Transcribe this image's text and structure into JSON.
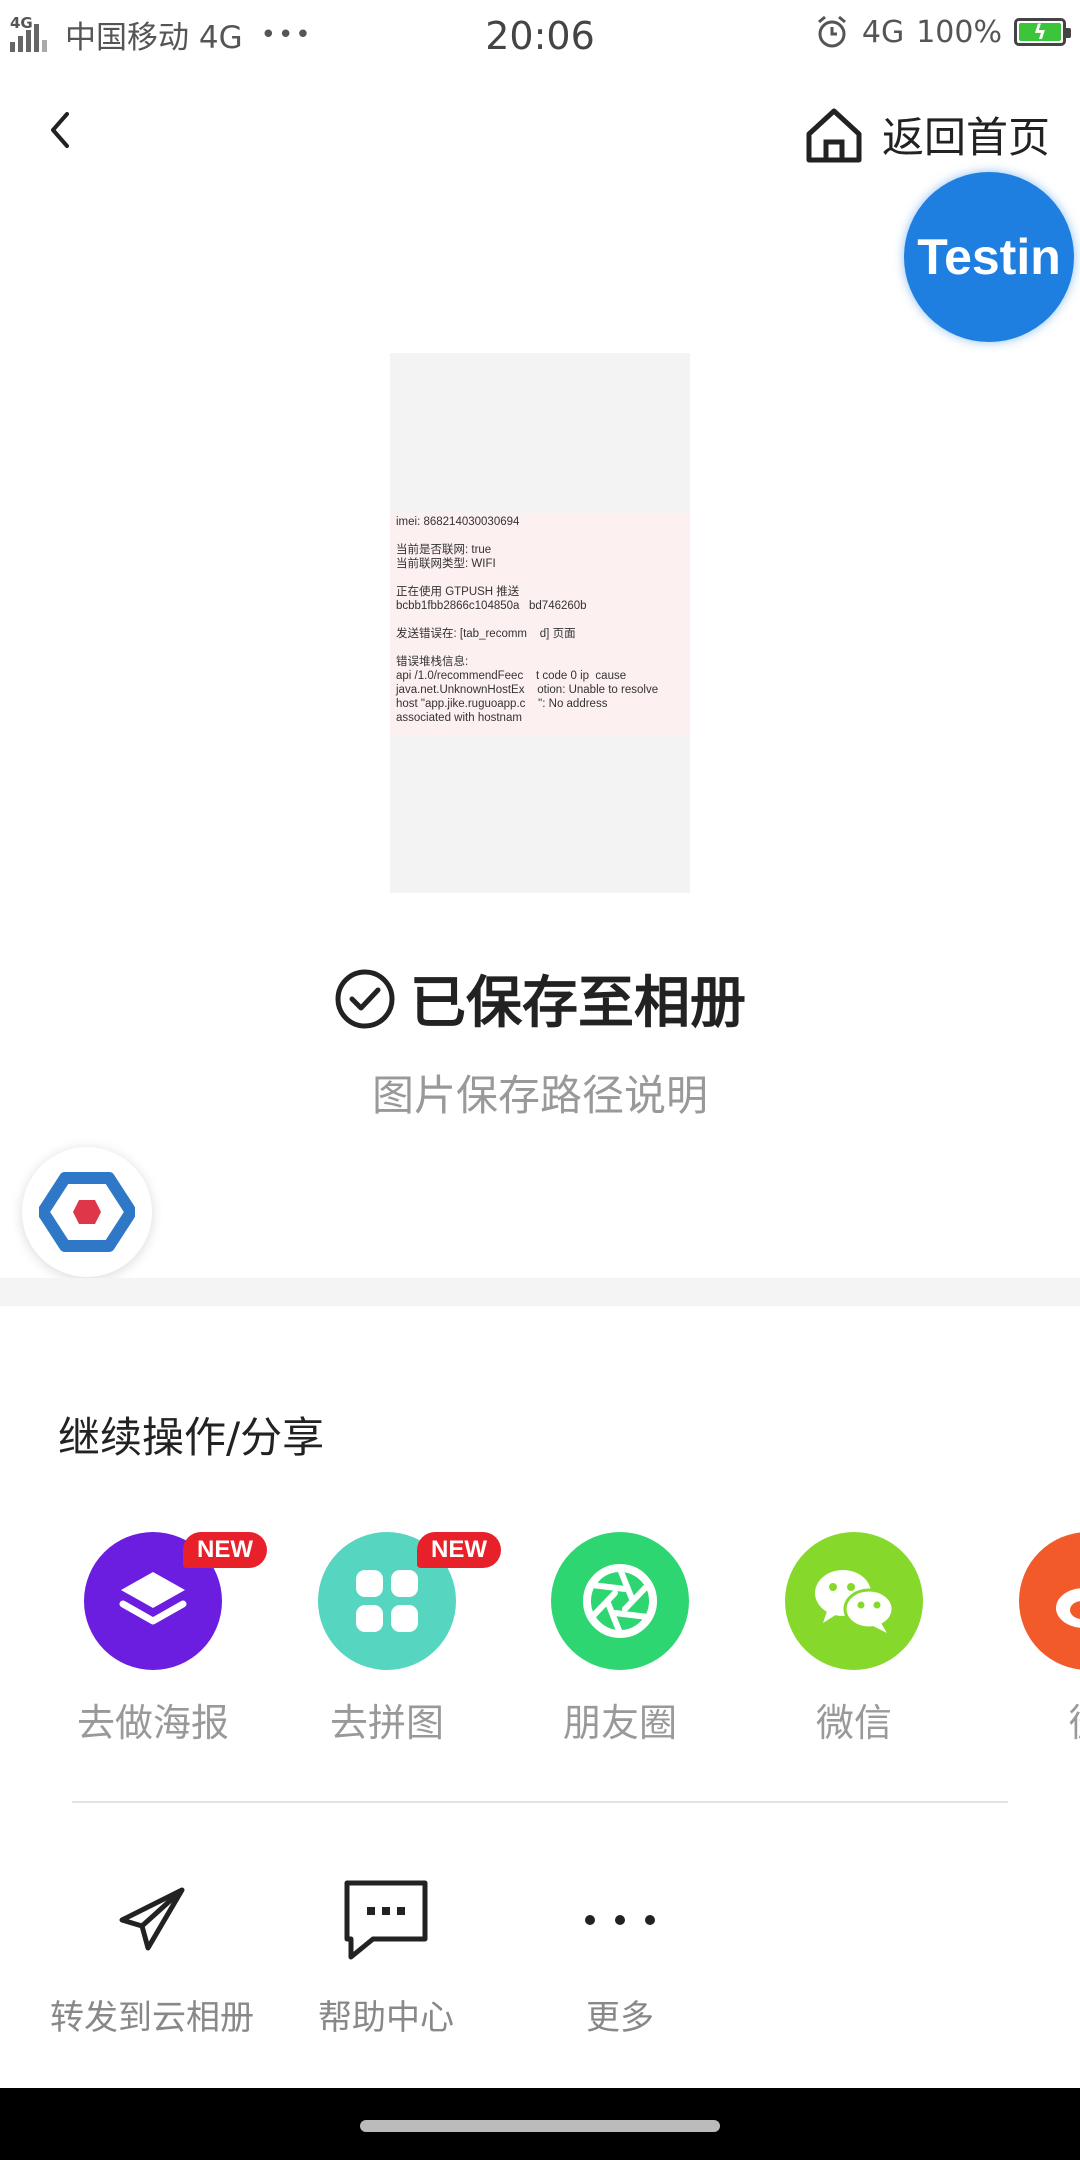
{
  "status_bar": {
    "network_small": "4G",
    "carrier": "中国移动 4G",
    "dots": "•••",
    "time": "20:06",
    "net_type": "4G",
    "battery": "100%"
  },
  "header": {
    "back_icon": "chevron-left-icon",
    "home_icon": "home-icon",
    "home_label": "返回首页",
    "testin_label": "Testin"
  },
  "preview": {
    "lines": [
      "imei: 868214030030694",
      "",
      "当前是否联网: true",
      "当前联网类型: WIFI",
      "",
      "正在使用 GTPUSH 推送",
      "bcbb1fbb2866c104850a   bd746260b",
      "",
      "发送错误在: [tab_recomm    d] 页面",
      "",
      "错误堆栈信息:",
      "api /1.0/recommendFeec    t code 0 ip  cause",
      "java.net.UnknownHostEx    otion: Unable to resolve",
      "host \"app.jike.ruguoapp.c    \": No address",
      "associated with hostnam"
    ]
  },
  "saved": {
    "icon": "check-circle-icon",
    "title": "已保存至相册",
    "path_note": "图片保存路径说明"
  },
  "share": {
    "section_title": "继续操作/分享",
    "items": [
      {
        "label": "去做海报",
        "badge": "NEW",
        "color": "#6b1ee0",
        "icon": "layers-icon"
      },
      {
        "label": "去拼图",
        "badge": "NEW",
        "color": "#56d5c0",
        "icon": "grid-icon"
      },
      {
        "label": "朋友圈",
        "badge": "",
        "color": "#2ed672",
        "icon": "aperture-icon"
      },
      {
        "label": "微信",
        "badge": "",
        "color": "#86d92a",
        "icon": "wechat-icon"
      },
      {
        "label": "微",
        "badge": "",
        "color": "#f25a2a",
        "icon": "weibo-icon"
      }
    ]
  },
  "tools": [
    {
      "label": "转发到云相册",
      "icon": "send-icon"
    },
    {
      "label": "帮助中心",
      "icon": "chat-bubble-icon"
    },
    {
      "label": "更多",
      "icon": "more-icon"
    }
  ]
}
